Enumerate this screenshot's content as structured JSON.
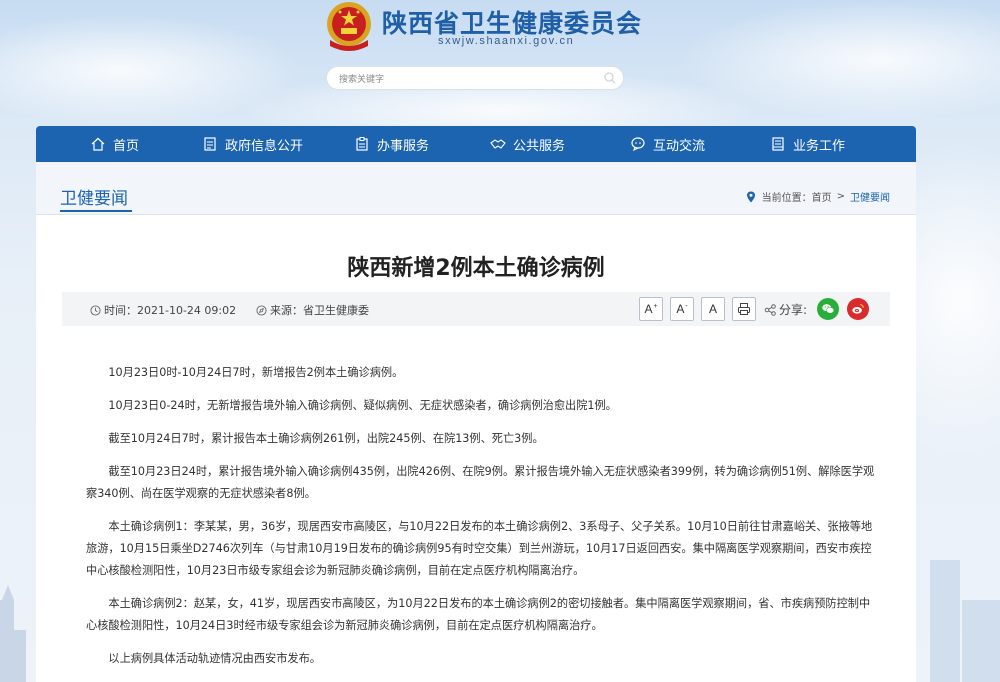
{
  "site": {
    "title": "陕西省卫生健康委员会",
    "domain": "sxwjw.shaanxi.gov.cn"
  },
  "search": {
    "placeholder": "搜索关键字"
  },
  "nav": {
    "items": [
      {
        "label": "首页",
        "icon": "home-icon"
      },
      {
        "label": "政府信息公开",
        "icon": "document-list-icon"
      },
      {
        "label": "办事服务",
        "icon": "clipboard-icon"
      },
      {
        "label": "公共服务",
        "icon": "handshake-icon"
      },
      {
        "label": "互动交流",
        "icon": "chat-bubble-icon"
      },
      {
        "label": "业务工作",
        "icon": "book-icon"
      }
    ]
  },
  "section": {
    "title": "卫健要闻",
    "breadcrumb": {
      "prefix": "当前位置：",
      "home": "首页",
      "separator": ">",
      "current": "卫健要闻"
    }
  },
  "article": {
    "title": "陕西新增2例本土确诊病例",
    "time_label": "时间：",
    "time": "2021-10-24 09:02",
    "source_label": "来源：",
    "source": "省卫生健康委",
    "font_buttons": [
      "A",
      "A",
      "A"
    ],
    "font_button_marks": [
      "+",
      "-"
    ],
    "share_label": "分享:",
    "paragraphs": [
      "10月23日0时-10月24日7时，新增报告2例本土确诊病例。",
      "10月23日0-24时，无新增报告境外输入确诊病例、疑似病例、无症状感染者，确诊病例治愈出院1例。",
      "截至10月24日7时，累计报告本土确诊病例261例，出院245例、在院13例、死亡3例。",
      "截至10月23日24时，累计报告境外输入确诊病例435例，出院426例、在院9例。累计报告境外输入无症状感染者399例，转为确诊病例51例、解除医学观察340例、尚在医学观察的无症状感染者8例。",
      "本土确诊病例1：李某某，男，36岁，现居西安市高陵区，与10月22日发布的本土确诊病例2、3系母子、父子关系。10月10日前往甘肃嘉峪关、张掖等地旅游，10月15日乘坐D2746次列车（与甘肃10月19日发布的确诊病例95有时空交集）到兰州游玩，10月17日返回西安。集中隔离医学观察期间，西安市疾控中心核酸检测阳性，10月23日市级专家组会诊为新冠肺炎确诊病例，目前在定点医疗机构隔离治疗。",
      "本土确诊病例2：赵某，女，41岁，现居西安市高陵区，为10月22日发布的本土确诊病例2的密切接触者。集中隔离医学观察期间，省、市疾病预防控制中心核酸检测阳性，10月24日3时经市级专家组会诊为新冠肺炎确诊病例，目前在定点医疗机构隔离治疗。",
      "以上病例具体活动轨迹情况由西安市发布。"
    ]
  },
  "colors": {
    "nav_bg": "#1c64b0",
    "title_blue": "#1f5fa8",
    "wechat_green": "#2aae3a",
    "weibo_red": "#d92b2b"
  }
}
